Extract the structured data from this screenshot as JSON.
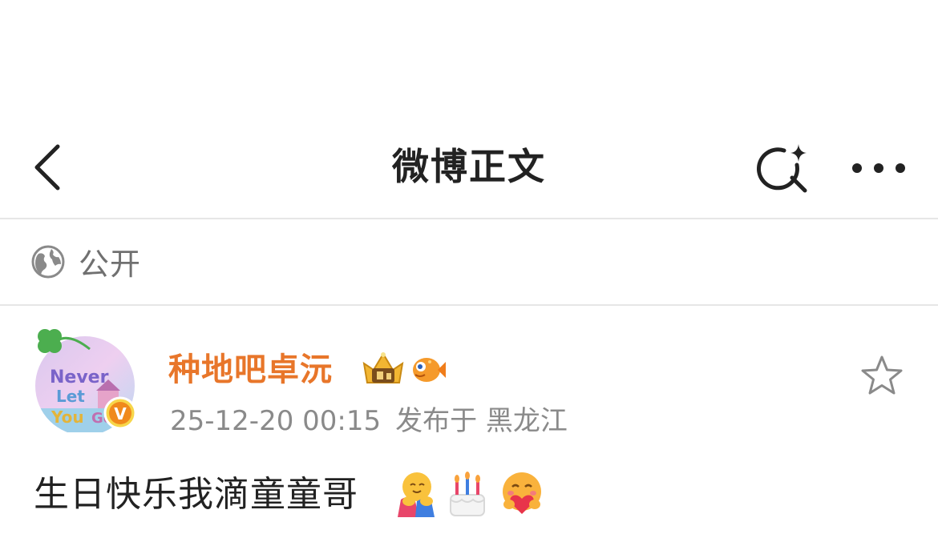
{
  "nav": {
    "title": "微博正文",
    "back_icon": "chevron-left-icon",
    "search_icon": "ai-search-icon",
    "more_icon": "more-dots-icon"
  },
  "visibility": {
    "icon": "globe-icon",
    "label": "公开"
  },
  "post": {
    "author": {
      "name": "种地吧卓沅",
      "name_color": "#e8762a",
      "avatar_text": "Never Let You Go",
      "verified_badge": "V",
      "badges": [
        "crown-badge-icon",
        "fish-badge-icon"
      ]
    },
    "timestamp": "25-12-20 00:15",
    "location": "发布于 黑龙江",
    "favorite_icon": "star-outline-icon",
    "text": "生日快乐我滴童童哥",
    "emojis": [
      "hug-emoji-icon",
      "birthday-cake-emoji-icon",
      "heart-hug-emoji-icon"
    ]
  },
  "colors": {
    "title_text": "#222222",
    "secondary_text": "#8a8a8a",
    "divider": "#e6e6e6",
    "accent_orange": "#e8762a"
  }
}
